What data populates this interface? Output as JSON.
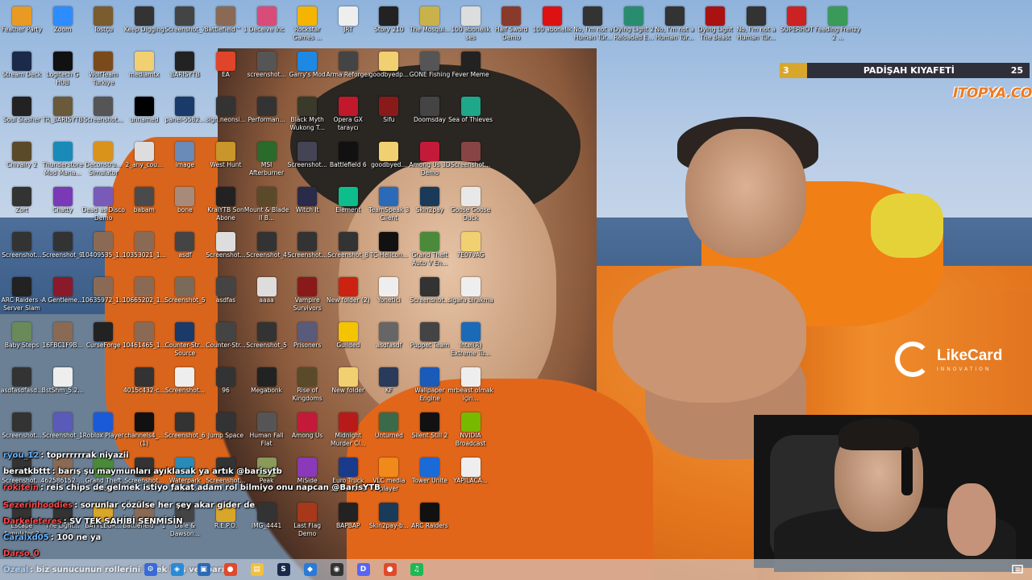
{
  "desktop_icons": [
    {
      "label": "Feather Party",
      "color": "#e89a22"
    },
    {
      "label": "Zoom",
      "color": "#2d8cff"
    },
    {
      "label": "Tostçu",
      "color": "#7a5c2e"
    },
    {
      "label": "Keep Digging",
      "color": "#333"
    },
    {
      "label": "Screenshot_7",
      "color": "#444"
    },
    {
      "label": "Battlefield™ 1",
      "color": "#8a6a55"
    },
    {
      "label": "Deceive Inc",
      "color": "#d94c7a"
    },
    {
      "label": "Rockstar Games ...",
      "color": "#f4b400"
    },
    {
      "label": "JRT",
      "color": "#eee"
    },
    {
      "label": "Story 210",
      "color": "#222"
    },
    {
      "label": "The Mosqui...",
      "color": "#c9b24a"
    },
    {
      "label": "100 abonelik ses",
      "color": "#ddd"
    },
    {
      "label": "Half Sword Demo",
      "color": "#8a3a2a"
    },
    {
      "label": "100 abonelik",
      "color": "#d11"
    },
    {
      "label": "No, I'm not a Human Tür...",
      "color": "#333"
    },
    {
      "label": "Dying Light 2 Reloaded E...",
      "color": "#2a8c6e"
    },
    {
      "label": "No, I'm not a Human Tür...",
      "color": "#333"
    },
    {
      "label": "Dying Light The Beast",
      "color": "#a11"
    },
    {
      "label": "No, I'm not a Human Tür...",
      "color": "#333"
    },
    {
      "label": "SUPERHOT",
      "color": "#c22"
    },
    {
      "label": "Feeding Frenzy 2 ...",
      "color": "#3a9a5a"
    },
    {
      "label": "Stream Deck",
      "color": "#1b2a4a"
    },
    {
      "label": "Logitech G HUB",
      "color": "#111"
    },
    {
      "label": "WolfTeam Turkiye",
      "color": "#7a4a1a"
    },
    {
      "label": "mediamtx",
      "color": "#f0d070"
    },
    {
      "label": "BARISYTB",
      "color": "#222"
    },
    {
      "label": "EA",
      "color": "#e0452a"
    },
    {
      "label": "screenshot...",
      "color": "#555"
    },
    {
      "label": "Garry's Mod",
      "color": "#1e88e5"
    },
    {
      "label": "Arma Reforger",
      "color": "#444"
    },
    {
      "label": "goodbyedp...",
      "color": "#f0d070"
    },
    {
      "label": "GONE Fishing",
      "color": "#555"
    },
    {
      "label": "Fever Meme",
      "color": "#222"
    },
    {
      "label": "Soul Slasher",
      "color": "#222"
    },
    {
      "label": "TR_BARISYTB",
      "color": "#6a5a3a"
    },
    {
      "label": "Screenshot...",
      "color": "#555"
    },
    {
      "label": "unnamed",
      "color": "#000"
    },
    {
      "label": "panel-5582...",
      "color": "#1a3a6a"
    },
    {
      "label": "sign.neonsi...",
      "color": "#333"
    },
    {
      "label": "Performan...",
      "color": "#333"
    },
    {
      "label": "Black Myth Wukong T...",
      "color": "#3a3a2a"
    },
    {
      "label": "Opera GX taraycı",
      "color": "#c2182c"
    },
    {
      "label": "Sifu",
      "color": "#8a1a1a"
    },
    {
      "label": "Doomsday",
      "color": "#444"
    },
    {
      "label": "Sea of Thieves",
      "color": "#1ea88a"
    },
    {
      "label": "Chivalry 2",
      "color": "#5a4a2a"
    },
    {
      "label": "Thunderstore Mod Mana...",
      "color": "#1a8ab8"
    },
    {
      "label": "Deconstru... Simulator",
      "color": "#d9921a"
    },
    {
      "label": "2_any_cou...",
      "color": "#ddd"
    },
    {
      "label": "image",
      "color": "#6a8ab8"
    },
    {
      "label": "West Hunt",
      "color": "#c8962a"
    },
    {
      "label": "MSI Afterburner",
      "color": "#2a6a2a"
    },
    {
      "label": "Screenshot...",
      "color": "#445"
    },
    {
      "label": "Battlefield 6",
      "color": "#111"
    },
    {
      "label": "goodbyed...",
      "color": "#f0d070"
    },
    {
      "label": "Among Us 3D Demo",
      "color": "#c41a3a"
    },
    {
      "label": "Screenshot...",
      "color": "#844"
    },
    {
      "label": "Zort",
      "color": "#333"
    },
    {
      "label": "Chatty",
      "color": "#7a3ab8"
    },
    {
      "label": "Dead as Disco Demo",
      "color": "#7a5ab8"
    },
    {
      "label": "babam",
      "color": "#4a4a4a"
    },
    {
      "label": "bone",
      "color": "#a88a7a"
    },
    {
      "label": "KralYTB Son Abone",
      "color": "#222"
    },
    {
      "label": "Mount & Blade II B...",
      "color": "#5a4a2a"
    },
    {
      "label": "Witch It",
      "color": "#2a2a4a"
    },
    {
      "label": "Element",
      "color": "#0dbd8b"
    },
    {
      "label": "TeamSpeak 3 Client",
      "color": "#2a6ab8"
    },
    {
      "label": "Skin2pay",
      "color": "#1a3a5a"
    },
    {
      "label": "Goose Goose Duck",
      "color": "#e8e8e8"
    },
    {
      "label": "Screenshot...",
      "color": "#333"
    },
    {
      "label": "Screenshot_9",
      "color": "#333"
    },
    {
      "label": "10409535_1...",
      "color": "#8a6a55"
    },
    {
      "label": "10353021_1...",
      "color": "#8a6a55"
    },
    {
      "label": "asdf",
      "color": "#444"
    },
    {
      "label": "Screenshot...",
      "color": "#ddd"
    },
    {
      "label": "Screenshot_4",
      "color": "#333"
    },
    {
      "label": "Screenshot...",
      "color": "#333"
    },
    {
      "label": "Screenshot_8",
      "color": "#333"
    },
    {
      "label": "TC-Helicon...",
      "color": "#111"
    },
    {
      "label": "Grand Theft Auto V En...",
      "color": "#4a8a3a"
    },
    {
      "label": "7E07vAG",
      "color": "#f0d070"
    },
    {
      "label": "ARC Raiders - Server Slam",
      "color": "#222"
    },
    {
      "label": "A Gentleme...",
      "color": "#8a1a2a"
    },
    {
      "label": "10635972_1...",
      "color": "#8a6a55"
    },
    {
      "label": "10665202_1...",
      "color": "#8a6a55"
    },
    {
      "label": "Screenshot_5",
      "color": "#7a6a5a"
    },
    {
      "label": "asdfas",
      "color": "#444"
    },
    {
      "label": "aaaa",
      "color": "#ddd"
    },
    {
      "label": "Vampire Survivors",
      "color": "#8a1a1a"
    },
    {
      "label": "New folder (2)",
      "color": "#c21"
    },
    {
      "label": "Yonetici",
      "color": "#eee"
    },
    {
      "label": "Screenshot...",
      "color": "#333"
    },
    {
      "label": "sigara birakma",
      "color": "#eee"
    },
    {
      "label": "Baby Steps",
      "color": "#6a8a5a"
    },
    {
      "label": "16FBC1F9B...",
      "color": "#8a6a55"
    },
    {
      "label": "CurseForge",
      "color": "#222"
    },
    {
      "label": "10461465_1...",
      "color": "#8a6a55"
    },
    {
      "label": "Counter-Str... Source",
      "color": "#1a3a6a"
    },
    {
      "label": "Counter-Str...",
      "color": "#444"
    },
    {
      "label": "Screenshot_5",
      "color": "#333"
    },
    {
      "label": "Prisoners",
      "color": "#5a5a7a"
    },
    {
      "label": "Guilded",
      "color": "#f5c400"
    },
    {
      "label": "asdfasdf",
      "color": "#666"
    },
    {
      "label": "Puppet Team",
      "color": "#444"
    },
    {
      "label": "Intel(R) Extreme Tu...",
      "color": "#1a6ab8"
    },
    {
      "label": "asdfasdfasd...",
      "color": "#333"
    },
    {
      "label": "BstShm_5.2...",
      "color": "#eee"
    },
    {
      "label": "",
      "color": "transparent"
    },
    {
      "label": "4015c432-c...",
      "color": "#333"
    },
    {
      "label": "Screenshot...",
      "color": "#eee"
    },
    {
      "label": "96",
      "color": "#333"
    },
    {
      "label": "Megabonk",
      "color": "#222"
    },
    {
      "label": "Rise of Kingdoms",
      "color": "#5a4a2a"
    },
    {
      "label": "New folder",
      "color": "#f0d070"
    },
    {
      "label": "KF",
      "color": "#2a3a5a"
    },
    {
      "label": "Wallpaper Engine",
      "color": "#1a5ab8"
    },
    {
      "label": "mrbeast olmak için...",
      "color": "#eee"
    },
    {
      "label": "Screenshot...",
      "color": "#333"
    },
    {
      "label": "Screenshot_1",
      "color": "#5a5ab8"
    },
    {
      "label": "Roblox Player",
      "color": "#1a5ad8"
    },
    {
      "label": "channels4_... (1)",
      "color": "#111"
    },
    {
      "label": "Screenshot_6",
      "color": "#333"
    },
    {
      "label": "Jump Space",
      "color": "#333"
    },
    {
      "label": "Human Fall Flat",
      "color": "#555"
    },
    {
      "label": "Among Us",
      "color": "#c41a3a"
    },
    {
      "label": "Midnight Murder Cl...",
      "color": "#b81a1a"
    },
    {
      "label": "Unturned",
      "color": "#3a6a4a"
    },
    {
      "label": "Silent Still 2",
      "color": "#111"
    },
    {
      "label": "NVIDIA Broadcast",
      "color": "#76b900"
    },
    {
      "label": "Screenshot...",
      "color": "#333"
    },
    {
      "label": "462586152_...",
      "color": "#8a6a55"
    },
    {
      "label": "Grand Theft Auto V",
      "color": "#4a8a3a"
    },
    {
      "label": "Screenshot...",
      "color": "#333"
    },
    {
      "label": "Waterpark Simulator",
      "color": "#2a8ab8"
    },
    {
      "label": "Screenshot...",
      "color": "#333"
    },
    {
      "label": "Peak",
      "color": "#8a9a5a"
    },
    {
      "label": "MiSide",
      "color": "#8a3ab8"
    },
    {
      "label": "Euro Truck Simulator 2",
      "color": "#1a3a8a"
    },
    {
      "label": "VLC media player",
      "color": "#f08a1a"
    },
    {
      "label": "Tower Unite",
      "color": "#1a6ad8"
    },
    {
      "label": "YAPILACA...",
      "color": "#eee"
    },
    {
      "label": "Escape Simulator 2",
      "color": "#333"
    },
    {
      "label": "The Light...",
      "color": "#333"
    },
    {
      "label": "BATTLEGR...",
      "color": "#d8a62a"
    },
    {
      "label": "Battlefield™ 1",
      "color": "#8a6a55"
    },
    {
      "label": "Dale & Dawson...",
      "color": "#444"
    },
    {
      "label": "R.E.P.O.",
      "color": "#d8a62a"
    },
    {
      "label": "IMG_4441",
      "color": "#333"
    },
    {
      "label": "Last Flag Demo",
      "color": "#a8381a"
    },
    {
      "label": "BAPBAP",
      "color": "#222"
    },
    {
      "label": "Skin2pay-b...",
      "color": "#1a3a5a"
    },
    {
      "label": "ARC Raiders",
      "color": "#111"
    }
  ],
  "overlay": {
    "rank_number": "3",
    "rank_title": "PADİŞAH KIYAFETİ",
    "rank_score": "25",
    "itopya": "ITOPYA.COM",
    "likecard": "LikeCard",
    "likecard_sub": "INNOVATION"
  },
  "chat": [
    {
      "user": "ryou_12",
      "text": "toprrrrrrak niyazii",
      "color": "#6ab4ff"
    },
    {
      "user": "beratkbttt",
      "text": "barış şu maymunları ayıklasak ya artık @barisytb",
      "color": "#fff"
    },
    {
      "user": "rokitein",
      "text": "reis chips de gelmek istiyo fakat adam rol bilmiyo onu napcan @BarisYTB",
      "color": "#ff4a4a"
    },
    {
      "user": "Sezerinhoodies",
      "text": "sorunlar çözülse her şey akar gider de",
      "color": "#ff4a4a"
    },
    {
      "user": "Darkeleteres",
      "text": "SV TEK SAHİBİ SENMİSİN",
      "color": "#ff4a4a"
    },
    {
      "user": "Caralxd05",
      "text": "100 ne ya",
      "color": "#6ab4ff"
    },
    {
      "user": "Darso_0",
      "text": "",
      "color": "#ff4a4a"
    },
    {
      "user": "Ozeal",
      "text": "biz sunucunun rollerini izliek boş ver barış",
      "color": "#6ab4ff"
    }
  ],
  "taskbar": {
    "apps": [
      {
        "name": "settings-icon",
        "color": "#3a6ad8",
        "glyph": "⚙"
      },
      {
        "name": "copilot-icon",
        "color": "#2a8ad8",
        "glyph": "◈"
      },
      {
        "name": "store-icon",
        "color": "#2a6ab8",
        "glyph": "▣"
      },
      {
        "name": "chrome-icon",
        "color": "#e04a2a",
        "glyph": "●"
      },
      {
        "name": "file-explorer-icon",
        "color": "#f0c040",
        "glyph": "▤"
      },
      {
        "name": "steam-icon",
        "color": "#1a2a4a",
        "glyph": "S"
      },
      {
        "name": "app-icon",
        "color": "#2a7ad8",
        "glyph": "◆"
      },
      {
        "name": "obs-icon",
        "color": "#333",
        "glyph": "◉"
      },
      {
        "name": "discord-icon",
        "color": "#5865f2",
        "glyph": "D"
      },
      {
        "name": "chrome-2-icon",
        "color": "#e04a2a",
        "glyph": "●"
      },
      {
        "name": "spotify-icon",
        "color": "#1db954",
        "glyph": "♫"
      }
    ]
  }
}
